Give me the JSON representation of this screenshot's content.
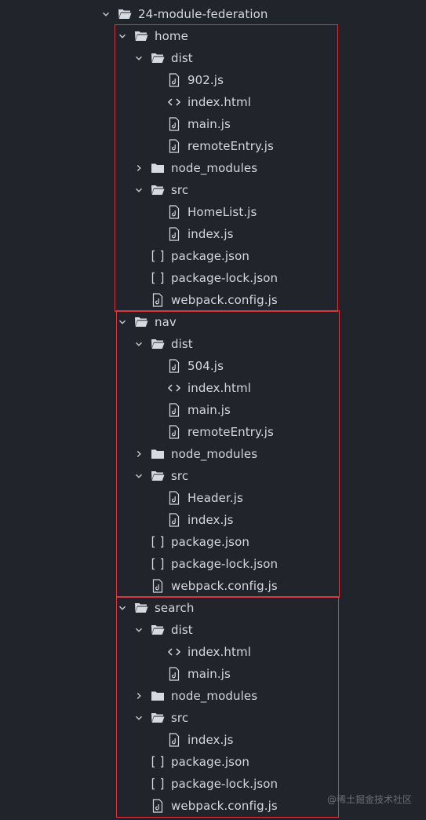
{
  "explorer": {
    "root": {
      "label": "24-module-federation",
      "children": [
        {
          "label": "home",
          "children": [
            {
              "label": "dist",
              "children": [
                {
                  "label": "902.js",
                  "icon": "js-file-icon"
                },
                {
                  "label": "index.html",
                  "icon": "html-file-icon"
                },
                {
                  "label": "main.js",
                  "icon": "js-file-icon"
                },
                {
                  "label": "remoteEntry.js",
                  "icon": "js-file-icon"
                }
              ]
            },
            {
              "label": "node_modules",
              "collapsed": true
            },
            {
              "label": "src",
              "children": [
                {
                  "label": "HomeList.js",
                  "icon": "js-file-icon"
                },
                {
                  "label": "index.js",
                  "icon": "js-file-icon"
                }
              ]
            },
            {
              "label": "package.json",
              "icon": "json-file-icon"
            },
            {
              "label": "package-lock.json",
              "icon": "json-file-icon"
            },
            {
              "label": "webpack.config.js",
              "icon": "js-file-icon"
            }
          ]
        },
        {
          "label": "nav",
          "children": [
            {
              "label": "dist",
              "children": [
                {
                  "label": "504.js",
                  "icon": "js-file-icon"
                },
                {
                  "label": "index.html",
                  "icon": "html-file-icon"
                },
                {
                  "label": "main.js",
                  "icon": "js-file-icon"
                },
                {
                  "label": "remoteEntry.js",
                  "icon": "js-file-icon"
                }
              ]
            },
            {
              "label": "node_modules",
              "collapsed": true
            },
            {
              "label": "src",
              "children": [
                {
                  "label": "Header.js",
                  "icon": "js-file-icon"
                },
                {
                  "label": "index.js",
                  "icon": "js-file-icon"
                }
              ]
            },
            {
              "label": "package.json",
              "icon": "json-file-icon"
            },
            {
              "label": "package-lock.json",
              "icon": "json-file-icon"
            },
            {
              "label": "webpack.config.js",
              "icon": "js-file-icon"
            }
          ]
        },
        {
          "label": "search",
          "children": [
            {
              "label": "dist",
              "children": [
                {
                  "label": "index.html",
                  "icon": "html-file-icon"
                },
                {
                  "label": "main.js",
                  "icon": "js-file-icon"
                }
              ]
            },
            {
              "label": "node_modules",
              "collapsed": true
            },
            {
              "label": "src",
              "children": [
                {
                  "label": "index.js",
                  "icon": "js-file-icon"
                }
              ]
            },
            {
              "label": "package.json",
              "icon": "json-file-icon"
            },
            {
              "label": "package-lock.json",
              "icon": "json-file-icon"
            },
            {
              "label": "webpack.config.js",
              "icon": "js-file-icon"
            }
          ]
        }
      ]
    }
  },
  "highlight_color": "#d9363e",
  "watermark": "@稀土掘金技术社区"
}
